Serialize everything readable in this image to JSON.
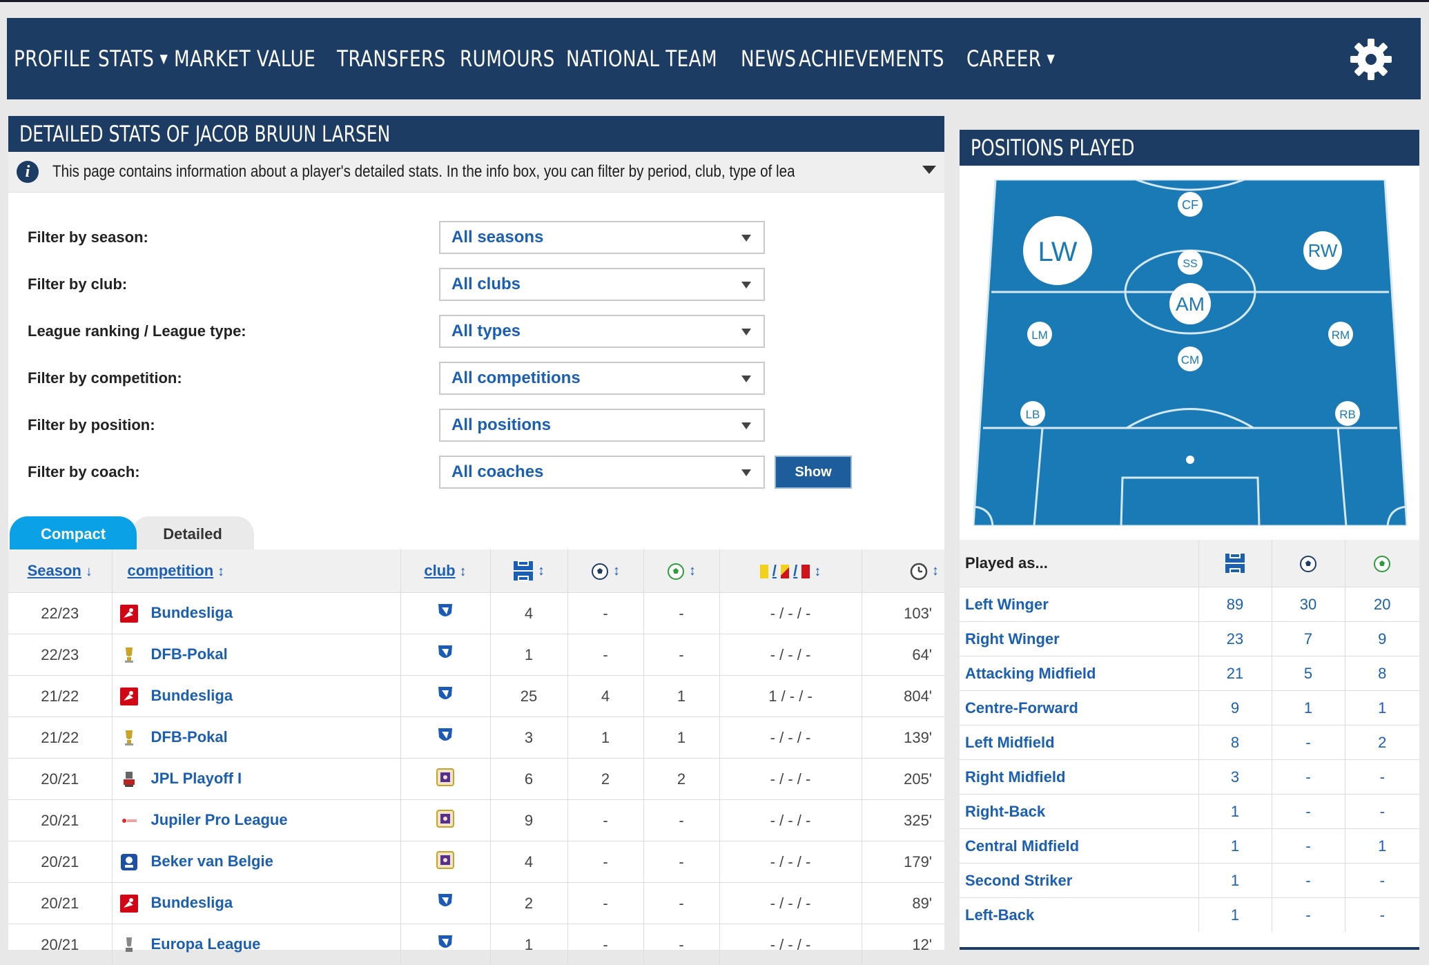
{
  "nav": {
    "items": [
      "PROFILE",
      "STATS",
      "MARKET VALUE",
      "TRANSFERS",
      "RUMOURS",
      "NATIONAL TEAM",
      "NEWS",
      "ACHIEVEMENTS",
      "CAREER"
    ],
    "dropdown_items": [
      "STATS",
      "CAREER"
    ],
    "settings_icon": "gear-icon"
  },
  "main": {
    "title": "DETAILED STATS OF JACOB BRUUN LARSEN",
    "info_text": "This page contains information about a player's detailed stats. In the info box, you can filter by period, club, type of league and competition. Th...",
    "filters": [
      {
        "label": "Filter by season:",
        "value": "All seasons"
      },
      {
        "label": "Filter by club:",
        "value": "All clubs"
      },
      {
        "label": "League ranking / League type:",
        "value": "All types"
      },
      {
        "label": "Filter by competition:",
        "value": "All competitions"
      },
      {
        "label": "Filter by position:",
        "value": "All positions"
      },
      {
        "label": "Filter by coach:",
        "value": "All coaches"
      }
    ],
    "show_button": "Show",
    "tabs": {
      "compact": "Compact",
      "detailed": "Detailed"
    },
    "columns": {
      "season": "Season",
      "competition": "competition",
      "club": "club",
      "slash1": "/",
      "slash2": "/"
    },
    "rows": [
      {
        "season": "22/23",
        "competition": "Bundesliga",
        "comp_logo": "bundesliga",
        "club_logo": "hoffenheim",
        "apps": "4",
        "goals": "-",
        "assists": "-",
        "cards": "- / - / -",
        "minutes": "103'"
      },
      {
        "season": "22/23",
        "competition": "DFB-Pokal",
        "comp_logo": "dfb-pokal",
        "club_logo": "hoffenheim",
        "apps": "1",
        "goals": "-",
        "assists": "-",
        "cards": "- / - / -",
        "minutes": "64'"
      },
      {
        "season": "21/22",
        "competition": "Bundesliga",
        "comp_logo": "bundesliga",
        "club_logo": "hoffenheim",
        "apps": "25",
        "goals": "4",
        "assists": "1",
        "cards": "1 / - / -",
        "minutes": "804'"
      },
      {
        "season": "21/22",
        "competition": "DFB-Pokal",
        "comp_logo": "dfb-pokal",
        "club_logo": "hoffenheim",
        "apps": "3",
        "goals": "1",
        "assists": "1",
        "cards": "- / - / -",
        "minutes": "139'"
      },
      {
        "season": "20/21",
        "competition": "JPL Playoff I",
        "comp_logo": "jpl-playoff",
        "club_logo": "anderlecht",
        "apps": "6",
        "goals": "2",
        "assists": "2",
        "cards": "- / - / -",
        "minutes": "205'"
      },
      {
        "season": "20/21",
        "competition": "Jupiler Pro League",
        "comp_logo": "jupiler",
        "club_logo": "anderlecht",
        "apps": "9",
        "goals": "-",
        "assists": "-",
        "cards": "- / - / -",
        "minutes": "325'"
      },
      {
        "season": "20/21",
        "competition": "Beker van Belgie",
        "comp_logo": "beker",
        "club_logo": "anderlecht",
        "apps": "4",
        "goals": "-",
        "assists": "-",
        "cards": "- / - / -",
        "minutes": "179'"
      },
      {
        "season": "20/21",
        "competition": "Bundesliga",
        "comp_logo": "bundesliga",
        "club_logo": "hoffenheim",
        "apps": "2",
        "goals": "-",
        "assists": "-",
        "cards": "- / - / -",
        "minutes": "89'"
      },
      {
        "season": "20/21",
        "competition": "Europa League",
        "comp_logo": "europa",
        "club_logo": "hoffenheim",
        "apps": "1",
        "goals": "-",
        "assists": "-",
        "cards": "- / - / -",
        "minutes": "12'"
      }
    ]
  },
  "positions": {
    "title": "POSITIONS PLAYED",
    "pitch_labels": {
      "CF": "CF",
      "LW": "LW",
      "RW": "RW",
      "SS": "SS",
      "AM": "AM",
      "LM": "LM",
      "RM": "RM",
      "CM": "CM",
      "LB": "LB",
      "RB": "RB"
    },
    "header": "Played as...",
    "rows": [
      {
        "position": "Left Winger",
        "apps": "89",
        "goals": "30",
        "assists": "20"
      },
      {
        "position": "Right Winger",
        "apps": "23",
        "goals": "7",
        "assists": "9"
      },
      {
        "position": "Attacking Midfield",
        "apps": "21",
        "goals": "5",
        "assists": "8"
      },
      {
        "position": "Centre-Forward",
        "apps": "9",
        "goals": "1",
        "assists": "1"
      },
      {
        "position": "Left Midfield",
        "apps": "8",
        "goals": "-",
        "assists": "2"
      },
      {
        "position": "Right Midfield",
        "apps": "3",
        "goals": "-",
        "assists": "-"
      },
      {
        "position": "Right-Back",
        "apps": "1",
        "goals": "-",
        "assists": "-"
      },
      {
        "position": "Central Midfield",
        "apps": "1",
        "goals": "-",
        "assists": "1"
      },
      {
        "position": "Second Striker",
        "apps": "1",
        "goals": "-",
        "assists": "-"
      },
      {
        "position": "Left-Back",
        "apps": "1",
        "goals": "-",
        "assists": "-"
      }
    ]
  },
  "colors": {
    "navy": "#1d3c64",
    "link": "#1a5fb4",
    "tab_active": "#0aa1e6",
    "pitch": "#1a7ab5"
  }
}
